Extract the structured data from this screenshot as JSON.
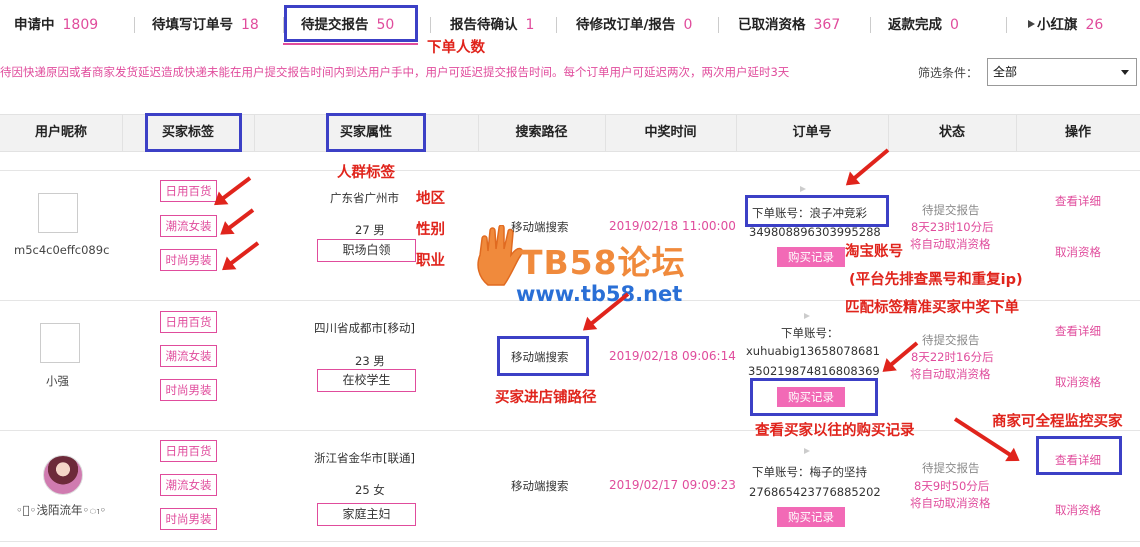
{
  "tabs": [
    {
      "label": "申请中",
      "count": "1809"
    },
    {
      "label": "待填写订单号",
      "count": "18"
    },
    {
      "label": "待提交报告",
      "count": "50"
    },
    {
      "label": "报告待确认",
      "count": "1"
    },
    {
      "label": "待修改订单/报告",
      "count": "0"
    },
    {
      "label": "已取消资格",
      "count": "367"
    },
    {
      "label": "返款完成",
      "count": "0"
    },
    {
      "label": "小红旗",
      "count": "26"
    }
  ],
  "notice": "待因快递原因或者商家发货延迟造成快递未能在用户提交报告时间内到达用户手中，用户可延迟提交报告时间。每个订单用户可延迟两次，两次用户延时3天",
  "filter": {
    "label": "筛选条件：",
    "value": "全部"
  },
  "columns": [
    "用户昵称",
    "买家标签",
    "买家属性",
    "搜索路径",
    "中奖时间",
    "订单号",
    "状态",
    "操作"
  ],
  "tag_labels": [
    "日用百货",
    "潮流女装",
    "时尚男装"
  ],
  "rows": [
    {
      "nickname": "m5c4c0effc089c",
      "region": "广东省广州市",
      "age_gender": "27 男",
      "job": "职场白领",
      "search_path": "移动端搜索",
      "win_time": "2019/02/18 11:00:00",
      "account": "下单账号：浪子冲竞彩",
      "order_no": "349808896303995288",
      "purchase_btn": "购买记录",
      "status": "待提交报告",
      "countdown": "8天23时10分后",
      "auto_cancel": "将自动取消资格",
      "detail_link": "查看详细",
      "cancel_link": "取消资格"
    },
    {
      "nickname": "小强",
      "region": "四川省成都市[移动]",
      "age_gender": "23 男",
      "job": "在校学生",
      "search_path": "移动端搜索",
      "win_time": "2019/02/18 09:06:14",
      "account_label": "下单账号：",
      "account": "xuhuabig13658078681",
      "order_no": "350219874816808369",
      "purchase_btn": "购买记录",
      "status": "待提交报告",
      "countdown": "8天22时16分后",
      "auto_cancel": "将自动取消资格",
      "detail_link": "查看详细",
      "cancel_link": "取消资格"
    },
    {
      "nickname": "浅陌流年",
      "nickname_deco_left": "◦ၢ◦",
      "nickname_deco_right": "◦ၢ◦",
      "region": "浙江省金华市[联通]",
      "age_gender": "25 女",
      "job": "家庭主妇",
      "search_path": "移动端搜索",
      "win_time": "2019/02/17 09:09:23",
      "account": "下单账号：梅子的坚持",
      "order_no": "276865423776885202",
      "purchase_btn": "购买记录",
      "status": "待提交报告",
      "countdown": "8天9时50分后",
      "auto_cancel": "将自动取消资格",
      "detail_link": "查看详细",
      "cancel_link": "取消资格"
    }
  ],
  "annotations": {
    "order_count": "下单人数",
    "crowd_tag": "人群标签",
    "region": "地区",
    "gender": "性别",
    "job": "职业",
    "taobao_account": "淘宝账号",
    "platform_check": "(平台先排查黑号和重复ip)",
    "match_tags": "匹配标签精准买家中奖下单",
    "entry_path": "买家进店铺路径",
    "history": "查看买家以往的购买记录",
    "monitor": "商家可全程监控买家"
  },
  "watermark": {
    "title": "TB58论坛",
    "url": "www.tb58.net"
  },
  "colors": {
    "accent": "#e04c9c",
    "annotation": "#e0241c",
    "highlight": "#3c40c6"
  }
}
